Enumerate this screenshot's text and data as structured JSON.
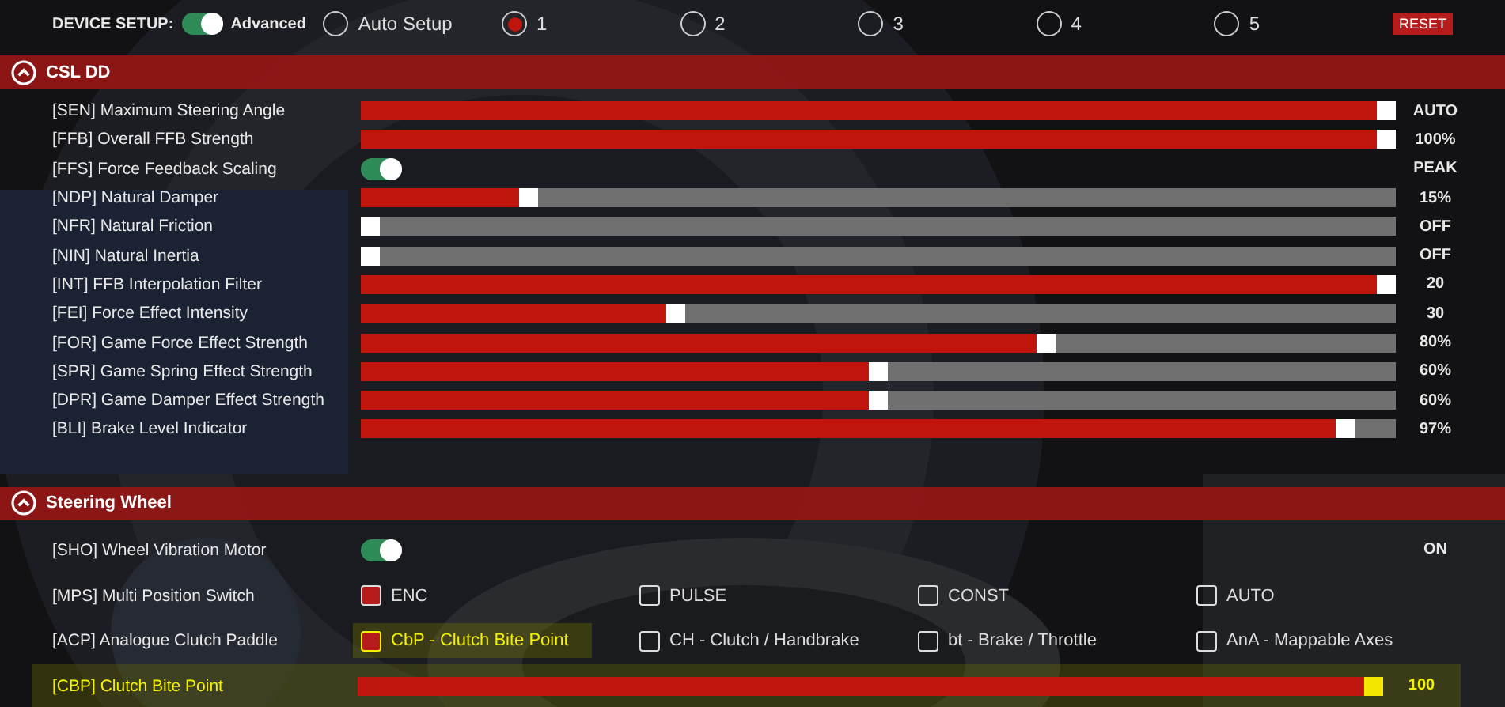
{
  "device_setup": {
    "label": "DEVICE SETUP:",
    "mode_toggle": {
      "on": true,
      "label": "Advanced"
    },
    "presets": [
      {
        "label": "Auto Setup",
        "selected": false
      },
      {
        "label": "1",
        "selected": true
      },
      {
        "label": "2",
        "selected": false
      },
      {
        "label": "3",
        "selected": false
      },
      {
        "label": "4",
        "selected": false
      },
      {
        "label": "5",
        "selected": false
      }
    ],
    "reset_button": "RESET"
  },
  "sections": [
    {
      "title": "CSL DD",
      "expanded": true,
      "rows": [
        {
          "kind": "slider",
          "label": "[SEN] Maximum Steering Angle",
          "level": 1.0,
          "reading": "AUTO"
        },
        {
          "kind": "slider",
          "label": "[FFB]  Overall FFB Strength",
          "level": 1.0,
          "reading": "100%"
        },
        {
          "kind": "toggle",
          "label": "[FFS] Force Feedback Scaling",
          "on": true,
          "reading": "PEAK"
        },
        {
          "kind": "slider",
          "label": "[NDP] Natural Damper",
          "level": 0.155,
          "reading": "15%"
        },
        {
          "kind": "slider",
          "label": "[NFR] Natural Friction",
          "level": 0,
          "reading": "OFF"
        },
        {
          "kind": "slider",
          "label": "[NIN] Natural Inertia",
          "level": 0,
          "reading": "OFF"
        },
        {
          "kind": "slider",
          "label": "[INT] FFB Interpolation Filter",
          "level": 1.0,
          "reading": "20"
        },
        {
          "kind": "slider",
          "label": "[FEI] Force Effect Intensity",
          "level": 0.3,
          "reading": "30"
        },
        {
          "kind": "slider",
          "label": "[FOR] Game Force Effect Strength",
          "level": 0.665,
          "reading": "80%"
        },
        {
          "kind": "slider",
          "label": "[SPR] Game Spring Effect Strength",
          "level": 0.5,
          "reading": "60%"
        },
        {
          "kind": "slider",
          "label": "[DPR] Game Damper Effect Strength",
          "level": 0.5,
          "reading": "60%"
        },
        {
          "kind": "slider",
          "label": "[BLI] Brake Level Indicator",
          "level": 0.96,
          "reading": "97%"
        }
      ]
    },
    {
      "title": "Steering Wheel",
      "expanded": true,
      "rows": [
        {
          "kind": "toggle",
          "label": "[SHO] Wheel Vibration Motor",
          "on": true,
          "reading": "ON"
        },
        {
          "kind": "options",
          "label": "[MPS] Multi Position Switch",
          "options": [
            {
              "label": "ENC",
              "checked": true,
              "highlighted": false
            },
            {
              "label": "PULSE",
              "checked": false,
              "highlighted": false
            },
            {
              "label": "CONST",
              "checked": false,
              "highlighted": false
            },
            {
              "label": "AUTO",
              "checked": false,
              "highlighted": false
            }
          ]
        },
        {
          "kind": "options",
          "label": "[ACP] Analogue Clutch Paddle",
          "options": [
            {
              "label": "CbP - Clutch Bite Point",
              "checked": true,
              "highlighted": true
            },
            {
              "label": "CH - Clutch / Handbrake",
              "checked": false,
              "highlighted": false
            },
            {
              "label": "bt - Brake / Throttle",
              "checked": false,
              "highlighted": false
            },
            {
              "label": "AnA - Mappable Axes",
              "checked": false,
              "highlighted": false
            }
          ]
        },
        {
          "kind": "slider",
          "label": "[CBP] Clutch Bite Point",
          "level": 1.0,
          "reading": "100",
          "highlighted": true
        }
      ]
    }
  ]
}
